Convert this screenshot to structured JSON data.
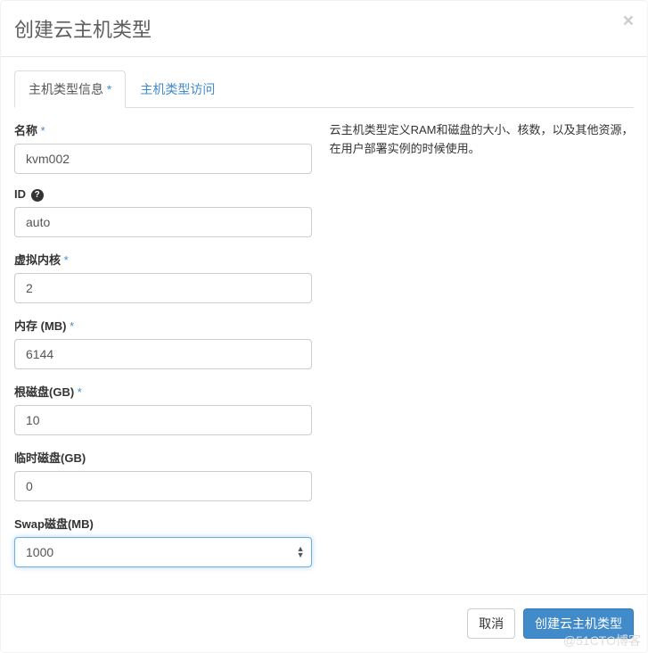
{
  "modal": {
    "title": "创建云主机类型",
    "close_icon": "×"
  },
  "tabs": [
    {
      "label": "主机类型信息",
      "required_mark": "*",
      "active": true
    },
    {
      "label": "主机类型访问",
      "required_mark": "",
      "active": false
    }
  ],
  "help_text": "云主机类型定义RAM和磁盘的大小、核数，以及其他资源，在用户部署实例的时候使用。",
  "fields": {
    "name": {
      "label": "名称",
      "required": "*",
      "value": "kvm002"
    },
    "id": {
      "label": "ID",
      "help_icon": "?",
      "value": "auto"
    },
    "vcpus": {
      "label": "虚拟内核",
      "required": "*",
      "value": "2"
    },
    "ram": {
      "label": "内存 (MB)",
      "required": "*",
      "value": "6144"
    },
    "root_disk": {
      "label": "根磁盘(GB)",
      "required": "*",
      "value": "10"
    },
    "ephemeral": {
      "label": "临时磁盘(GB)",
      "value": "0"
    },
    "swap": {
      "label": "Swap磁盘(MB)",
      "value": "1000"
    }
  },
  "footer": {
    "cancel": "取消",
    "submit": "创建云主机类型"
  },
  "watermark": "@51CTO博客"
}
